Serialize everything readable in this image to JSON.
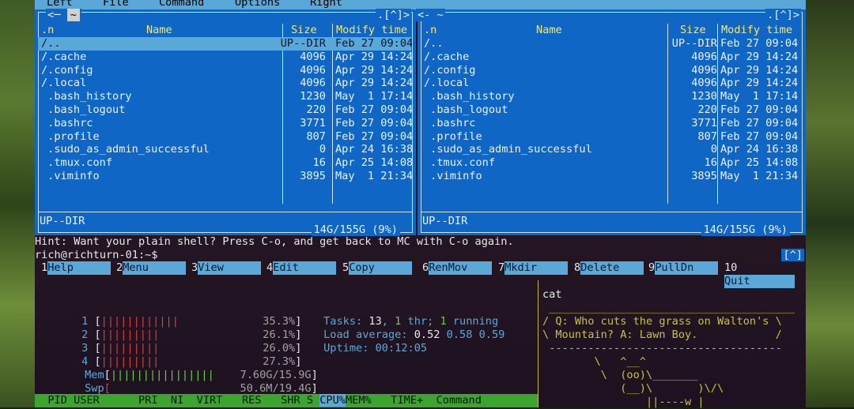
{
  "menu": {
    "items": [
      "Left",
      "File",
      "Command",
      "Options",
      "Right"
    ]
  },
  "left_panel": {
    "path_indicator": "~",
    "history_indicator": ".[^]>",
    "columns": {
      "n": ".n",
      "name": "Name",
      "size": "Size",
      "mtime": "Modify time"
    },
    "rows": [
      {
        "name": "/..",
        "size": "UP--DIR",
        "date": "Feb 27 09:04",
        "selected": true
      },
      {
        "name": "/.cache",
        "size": "4096",
        "date": "Apr 29 14:24"
      },
      {
        "name": "/.config",
        "size": "4096",
        "date": "Apr 29 14:24"
      },
      {
        "name": "/.local",
        "size": "4096",
        "date": "Apr 29 14:24"
      },
      {
        "name": " .bash_history",
        "size": "1230",
        "date": "May  1 17:14"
      },
      {
        "name": " .bash_logout",
        "size": "220",
        "date": "Feb 27 09:04"
      },
      {
        "name": " .bashrc",
        "size": "3771",
        "date": "Feb 27 09:04"
      },
      {
        "name": " .profile",
        "size": "807",
        "date": "Feb 27 09:04"
      },
      {
        "name": " .sudo_as_admin_successful",
        "size": "0",
        "date": "Apr 24 16:38"
      },
      {
        "name": " .tmux.conf",
        "size": "16",
        "date": "Apr 25 14:08"
      },
      {
        "name": " .viminfo",
        "size": "3895",
        "date": "May  1 21:34"
      }
    ],
    "status": "UP--DIR",
    "disk": "14G/155G (9%)"
  },
  "right_panel": {
    "path_indicator": "<- ~",
    "history_indicator": ".[^]>",
    "columns": {
      "n": ".n",
      "name": "Name",
      "size": "Size",
      "mtime": "Modify time"
    },
    "rows": [
      {
        "name": "/..",
        "size": "UP--DIR",
        "date": "Feb 27 09:04"
      },
      {
        "name": "/.cache",
        "size": "4096",
        "date": "Apr 29 14:24"
      },
      {
        "name": "/.config",
        "size": "4096",
        "date": "Apr 29 14:24"
      },
      {
        "name": "/.local",
        "size": "4096",
        "date": "Apr 29 14:24"
      },
      {
        "name": " .bash_history",
        "size": "1230",
        "date": "May  1 17:14"
      },
      {
        "name": " .bash_logout",
        "size": "220",
        "date": "Feb 27 09:04"
      },
      {
        "name": " .bashrc",
        "size": "3771",
        "date": "Feb 27 09:04"
      },
      {
        "name": " .profile",
        "size": "807",
        "date": "Feb 27 09:04"
      },
      {
        "name": " .sudo_as_admin_successful",
        "size": "0",
        "date": "Apr 24 16:38"
      },
      {
        "name": " .tmux.conf",
        "size": "16",
        "date": "Apr 25 14:08"
      },
      {
        "name": " .viminfo",
        "size": "3895",
        "date": "May  1 21:34"
      }
    ],
    "status": "UP--DIR",
    "disk": "14G/155G (9%)"
  },
  "hint": "Hint: Want your plain shell? Press C-o, and get back to MC with C-o again.",
  "prompt": "rich@richturn-01:~$",
  "prompt_tag": "[^]",
  "function_keys": [
    {
      "num": "1",
      "label": "Help"
    },
    {
      "num": "2",
      "label": "Menu"
    },
    {
      "num": "3",
      "label": "View"
    },
    {
      "num": "4",
      "label": "Edit"
    },
    {
      "num": "5",
      "label": "Copy"
    },
    {
      "num": "6",
      "label": "RenMov"
    },
    {
      "num": "7",
      "label": "Mkdir"
    },
    {
      "num": "8",
      "label": "Delete"
    },
    {
      "num": "9",
      "label": "PullDn"
    },
    {
      "num": "10",
      "label": "Quit"
    }
  ],
  "htop": {
    "cpus": [
      {
        "n": "1",
        "bar": "||||||||||||",
        "pct": "35.3%"
      },
      {
        "n": "2",
        "bar": "|||||||||",
        "pct": "26.1%"
      },
      {
        "n": "3",
        "bar": "|||||||||",
        "pct": "26.0%"
      },
      {
        "n": "4",
        "bar": "|||||||||",
        "pct": "27.3%"
      }
    ],
    "mem": {
      "label": "Mem",
      "bar": "||||||||||||||||",
      "value": "7.60G/15.9G"
    },
    "swp": {
      "label": "Swp",
      "bar": "",
      "value": "50.6M/19.4G"
    },
    "tasks_label": "Tasks:",
    "tasks": "13",
    "thr": "1",
    "thr_label": "thr;",
    "running": "1",
    "running_label": "running",
    "load_label": "Load average:",
    "load1": "0.52",
    "load5": "0.58",
    "load15": "0.59",
    "uptime_label": "Uptime:",
    "uptime": "00:12:05",
    "header": {
      "pid": "PID",
      "user": "USER",
      "pri": "PRI",
      "ni": "NI",
      "virt": "VIRT",
      "res": "RES",
      "shr": "SHR",
      "s": "S",
      "cpu": "CPU%",
      "mem": "MEM%",
      "time": "TIME+",
      "command": "Command"
    }
  },
  "cowsay": {
    "command": "cat",
    "lines": [
      " ______________________________________",
      "/ Q: Who cuts the grass on Walton's \\",
      "\\ Mountain? A: Lawn Boy.            /",
      " ------------------------------------",
      "        \\   ^__^",
      "         \\  (oo)\\_______",
      "            (__)\\       )\\/\\",
      "                ||----w |"
    ]
  }
}
